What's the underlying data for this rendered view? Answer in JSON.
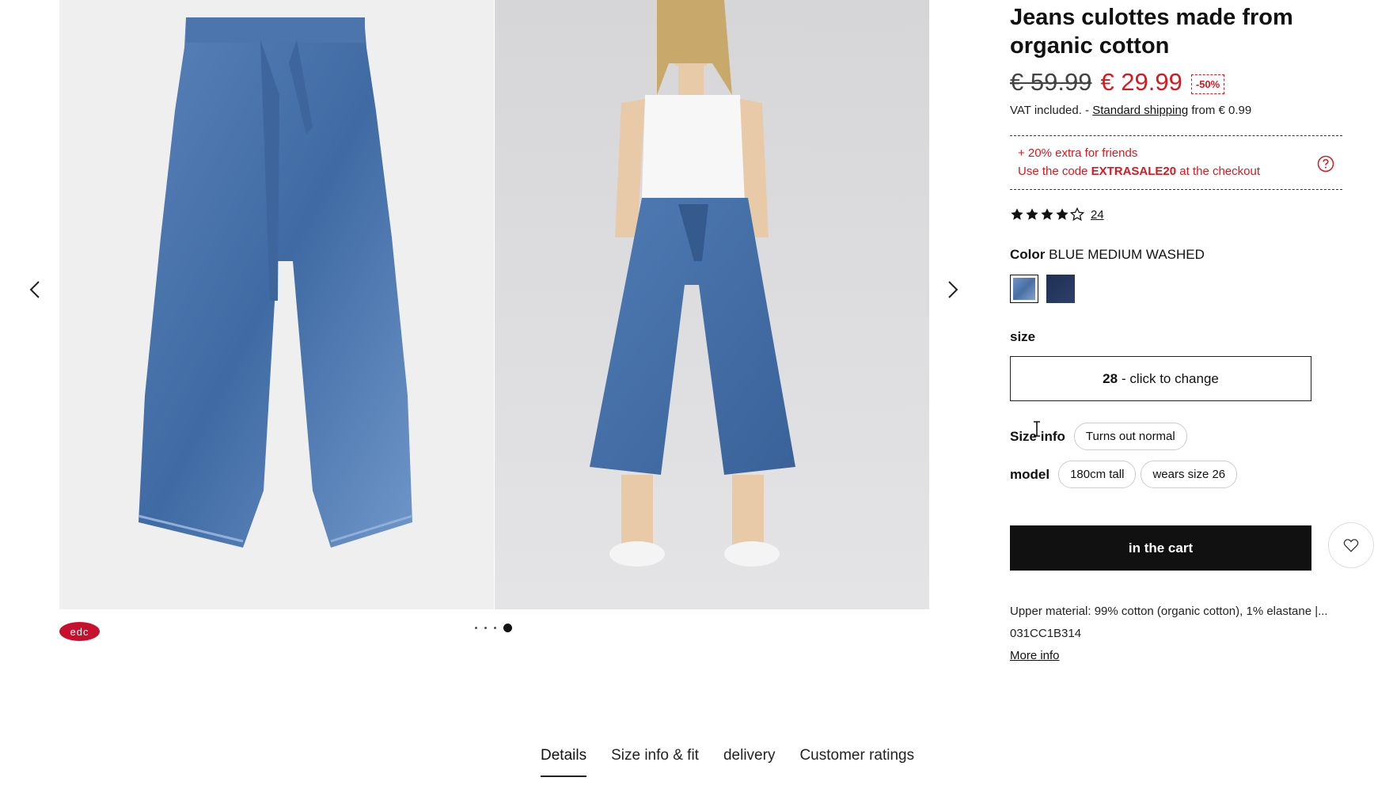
{
  "product": {
    "title": "Jeans culottes made from organic cotton",
    "old_price": "€ 59.99",
    "new_price": "€ 29.99",
    "discount": "-50%",
    "vat_prefix": "VAT included. -",
    "shipping_link": "Standard shipping",
    "shipping_suffix": "from € 0.99"
  },
  "promo": {
    "line1": "+ 20% extra for friends",
    "line2_prefix": "Use the code",
    "code": "EXTRASALE20",
    "line2_suffix": "at the checkout",
    "icon": "help-circle-icon"
  },
  "rating": {
    "stars": 4,
    "max": 5,
    "count": "24"
  },
  "color": {
    "label": "Color",
    "value": "BLUE MEDIUM WASHED",
    "swatches": [
      "#5b7fb5",
      "#26365c"
    ]
  },
  "size": {
    "label": "size",
    "current": "28",
    "action": "- click to change"
  },
  "size_info": {
    "label": "Size info",
    "chip": "Turns out normal"
  },
  "model": {
    "label": "model",
    "chips": [
      "180cm tall",
      "wears size 26"
    ]
  },
  "cart": {
    "label": "in the cart"
  },
  "details": {
    "material": "Upper material: 99% cotton (organic cotton), 1% elastane |...",
    "sku": "031CC1B314",
    "more": "More info"
  },
  "brand": {
    "logo_text": "edc",
    "color": "#c8102e"
  },
  "gallery": {
    "total_images": 4,
    "active_index": 3
  },
  "tabs": [
    "Details",
    "Size info & fit",
    "delivery",
    "Customer ratings"
  ],
  "colors": {
    "sale_red": "#d71920",
    "button_black": "#111111"
  }
}
